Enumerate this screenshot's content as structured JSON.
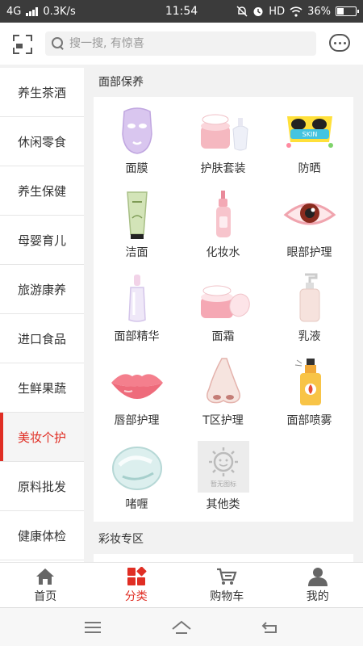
{
  "status_bar": {
    "network": "4G",
    "speed": "0.3K/s",
    "time": "11:54",
    "hd": "HD",
    "battery": "36%",
    "battery_level": 0.36
  },
  "header": {
    "search_placeholder": "搜一搜, 有惊喜"
  },
  "sidebar": {
    "items": [
      {
        "label": "养生茶酒"
      },
      {
        "label": "休闲零食"
      },
      {
        "label": "养生保健"
      },
      {
        "label": "母婴育儿"
      },
      {
        "label": "旅游康养"
      },
      {
        "label": "进口食品"
      },
      {
        "label": "生鲜果蔬"
      },
      {
        "label": "美妆个护",
        "active": true
      },
      {
        "label": "原料批发"
      },
      {
        "label": "健康体检"
      }
    ]
  },
  "main": {
    "section1_title": "面部保养",
    "items": [
      {
        "label": "面膜",
        "icon": "face-mask-icon"
      },
      {
        "label": "护肤套装",
        "icon": "skincare-set-icon"
      },
      {
        "label": "防晒",
        "icon": "sunscreen-icon"
      },
      {
        "label": "洁面",
        "icon": "cleanser-tube-icon"
      },
      {
        "label": "化妆水",
        "icon": "toner-bottle-icon"
      },
      {
        "label": "眼部护理",
        "icon": "eye-icon"
      },
      {
        "label": "面部精华",
        "icon": "serum-bottle-icon"
      },
      {
        "label": "面霜",
        "icon": "cream-jar-icon"
      },
      {
        "label": "乳液",
        "icon": "lotion-pump-icon"
      },
      {
        "label": "唇部护理",
        "icon": "lips-icon"
      },
      {
        "label": "T区护理",
        "icon": "nose-icon"
      },
      {
        "label": "面部喷雾",
        "icon": "spray-bottle-icon"
      },
      {
        "label": "啫喱",
        "icon": "gel-swatch-icon"
      },
      {
        "label": "其他类",
        "icon": "placeholder-icon",
        "placeholder_text": "暂无图标"
      }
    ],
    "section2_title": "彩妆专区"
  },
  "bottom_nav": [
    {
      "label": "首页",
      "icon": "home-icon"
    },
    {
      "label": "分类",
      "icon": "category-icon",
      "active": true
    },
    {
      "label": "购物车",
      "icon": "cart-icon"
    },
    {
      "label": "我的",
      "icon": "user-icon"
    }
  ],
  "colors": {
    "accent": "#e02e24",
    "status_bar": "#3b3b3b",
    "background": "#f2f2f2"
  }
}
